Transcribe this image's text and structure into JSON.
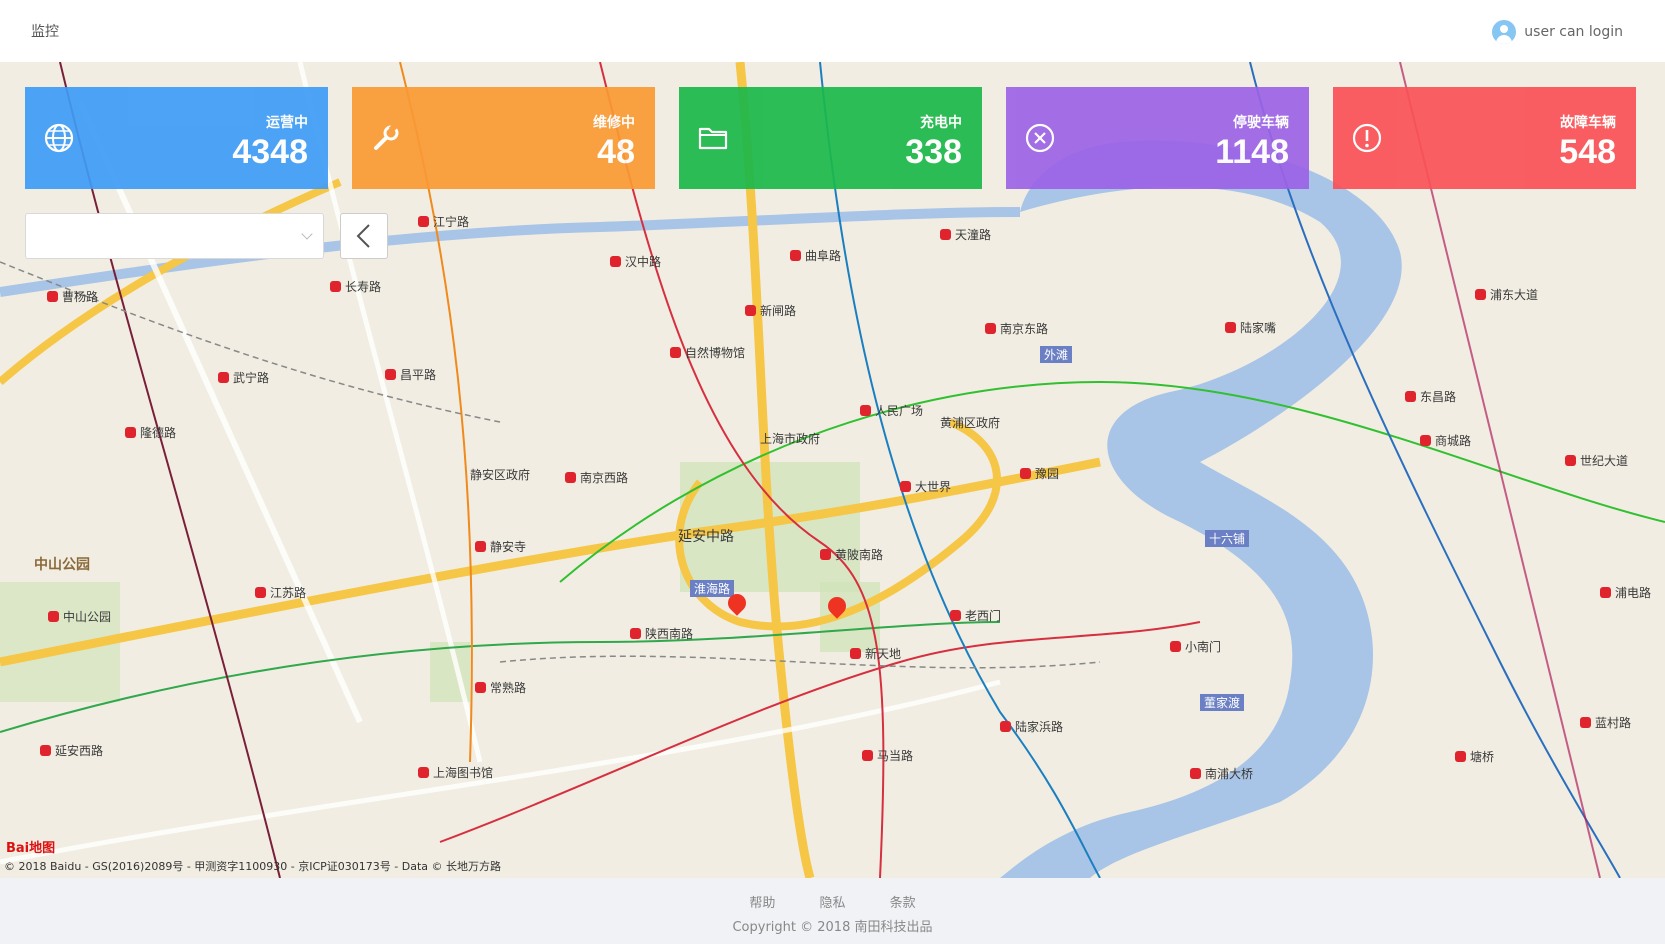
{
  "header": {
    "title": "监控",
    "user": "user can login"
  },
  "cards": [
    {
      "label": "运营中",
      "value": "4348",
      "icon": "globe-icon",
      "color": "#3f9cf6"
    },
    {
      "label": "维修中",
      "value": "48",
      "icon": "wrench-icon",
      "color": "#fa9a34"
    },
    {
      "label": "充电中",
      "value": "338",
      "icon": "folder-icon",
      "color": "#1bb84b"
    },
    {
      "label": "停驶车辆",
      "value": "1148",
      "icon": "close-circle-icon",
      "color": "#9c63e6"
    },
    {
      "label": "故障车辆",
      "value": "548",
      "icon": "exclamation-circle-icon",
      "color": "#fa5157"
    }
  ],
  "select": {
    "value": ""
  },
  "map": {
    "labels": [
      "南京东路",
      "人民广场",
      "南京西路",
      "大世界",
      "黄陂南路",
      "新天地",
      "老西门",
      "陕西南路",
      "常熟路",
      "静安寺",
      "江苏路",
      "中山公园",
      "延安西路",
      "上海图书馆",
      "马当路",
      "陆家浜路",
      "小南门",
      "豫园",
      "陆家嘴",
      "东昌路",
      "商城路",
      "世纪大道",
      "浦东大道",
      "南浦大桥",
      "塘桥",
      "蓝村路",
      "浦电路",
      "曹杨路",
      "隆德路",
      "武宁路",
      "长寿路",
      "昌平路",
      "江宁路",
      "汉中路",
      "曲阜路",
      "天潼路",
      "新闸路",
      "自然博物馆",
      "延安中路",
      "淮海路",
      "外滩",
      "十六铺",
      "董家渡",
      "黄浦区政府",
      "上海市政府",
      "静安区政府",
      "中山公园"
    ],
    "copyright": "© 2018 Baidu - GS(2016)2089号 - 甲测资字1100930 - 京ICP证030173号 - Data © 长地万方路",
    "logo": "Bai地图"
  },
  "footer": {
    "links": [
      "帮助",
      "隐私",
      "条款"
    ],
    "copyright": "Copyright © 2018 南田科技出品"
  }
}
